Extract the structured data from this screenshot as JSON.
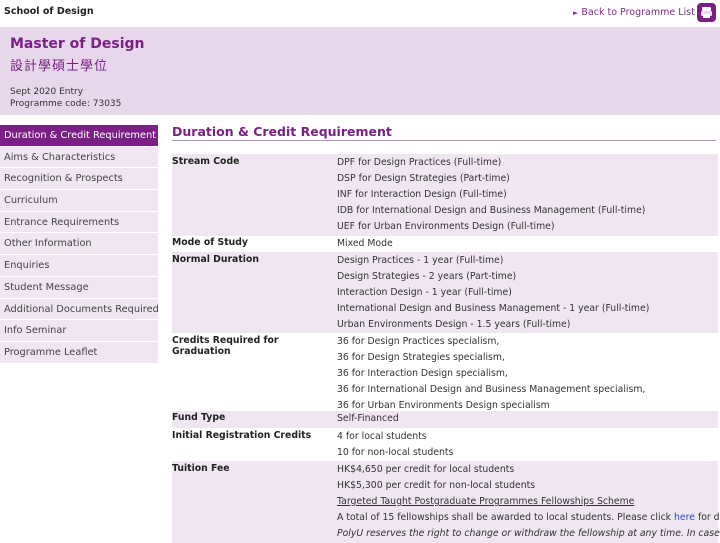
{
  "header": {
    "school": "School of Design",
    "back_link": "Back to Programme List"
  },
  "banner": {
    "title_en": "Master of Design",
    "title_zh": "設計學碩士學位",
    "entry": "Sept 2020 Entry",
    "code": "Programme code: 73035"
  },
  "sidebar": {
    "items": [
      {
        "label": "Duration & Credit Requirement",
        "active": true
      },
      {
        "label": "Aims & Characteristics"
      },
      {
        "label": "Recognition & Prospects"
      },
      {
        "label": "Curriculum"
      },
      {
        "label": "Entrance Requirements"
      },
      {
        "label": "Other Information"
      },
      {
        "label": "Enquiries"
      },
      {
        "label": "Student Message"
      },
      {
        "label": "Additional Documents Required"
      },
      {
        "label": "Info Seminar"
      },
      {
        "label": "Programme Leaflet"
      }
    ]
  },
  "main": {
    "title": "Duration & Credit Requirement",
    "rows": [
      {
        "label": "Stream Code",
        "values": [
          "DPF for Design Practices (Full-time)",
          "DSP for Design Strategies (Part-time)",
          "INF for Interaction Design (Full-time)",
          "IDB for International Design and Business Management (Full-time)",
          "UEF for Urban Environments Design (Full-time)"
        ]
      },
      {
        "label": "Mode of Study",
        "values": [
          "Mixed Mode"
        ]
      },
      {
        "label": "Normal Duration",
        "values": [
          "Design Practices - 1 year (Full-time)",
          "Design Strategies - 2 years (Part-time)",
          "Interaction Design - 1 year (Full-time)",
          "International Design and Business Management - 1 year (Full-time)",
          "Urban Environments Design - 1.5 years (Full-time)"
        ]
      },
      {
        "label": "Credits Required for Graduation",
        "values": [
          "36 for Design Practices specialism,",
          "36 for Design Strategies specialism,",
          "36 for Interaction Design specialism,",
          "36 for International Design and Business Management specialism,",
          "36 for Urban Environments Design specialism"
        ]
      },
      {
        "label": "Fund Type",
        "values": [
          "Self-Financed"
        ]
      },
      {
        "label": "Initial Registration Credits",
        "values": [
          "4 for local students",
          "10 for non-local students"
        ]
      },
      {
        "label": "Tuition Fee",
        "values": [
          "HK$4,650 per credit for local students",
          "HK$5,300 per credit for non-local students"
        ]
      }
    ],
    "fellowship_link": "Targeted Taught Postgraduate Programmes Fellowships Scheme",
    "fellowship_text_before": "A total of 15 fellowships shall be awarded to local students. Please click ",
    "fellowship_here": "here",
    "fellowship_text_after": " for details.",
    "fellowship_note": "PolyU reserves the right to change or withdraw the fellowship at any time. In case of"
  }
}
